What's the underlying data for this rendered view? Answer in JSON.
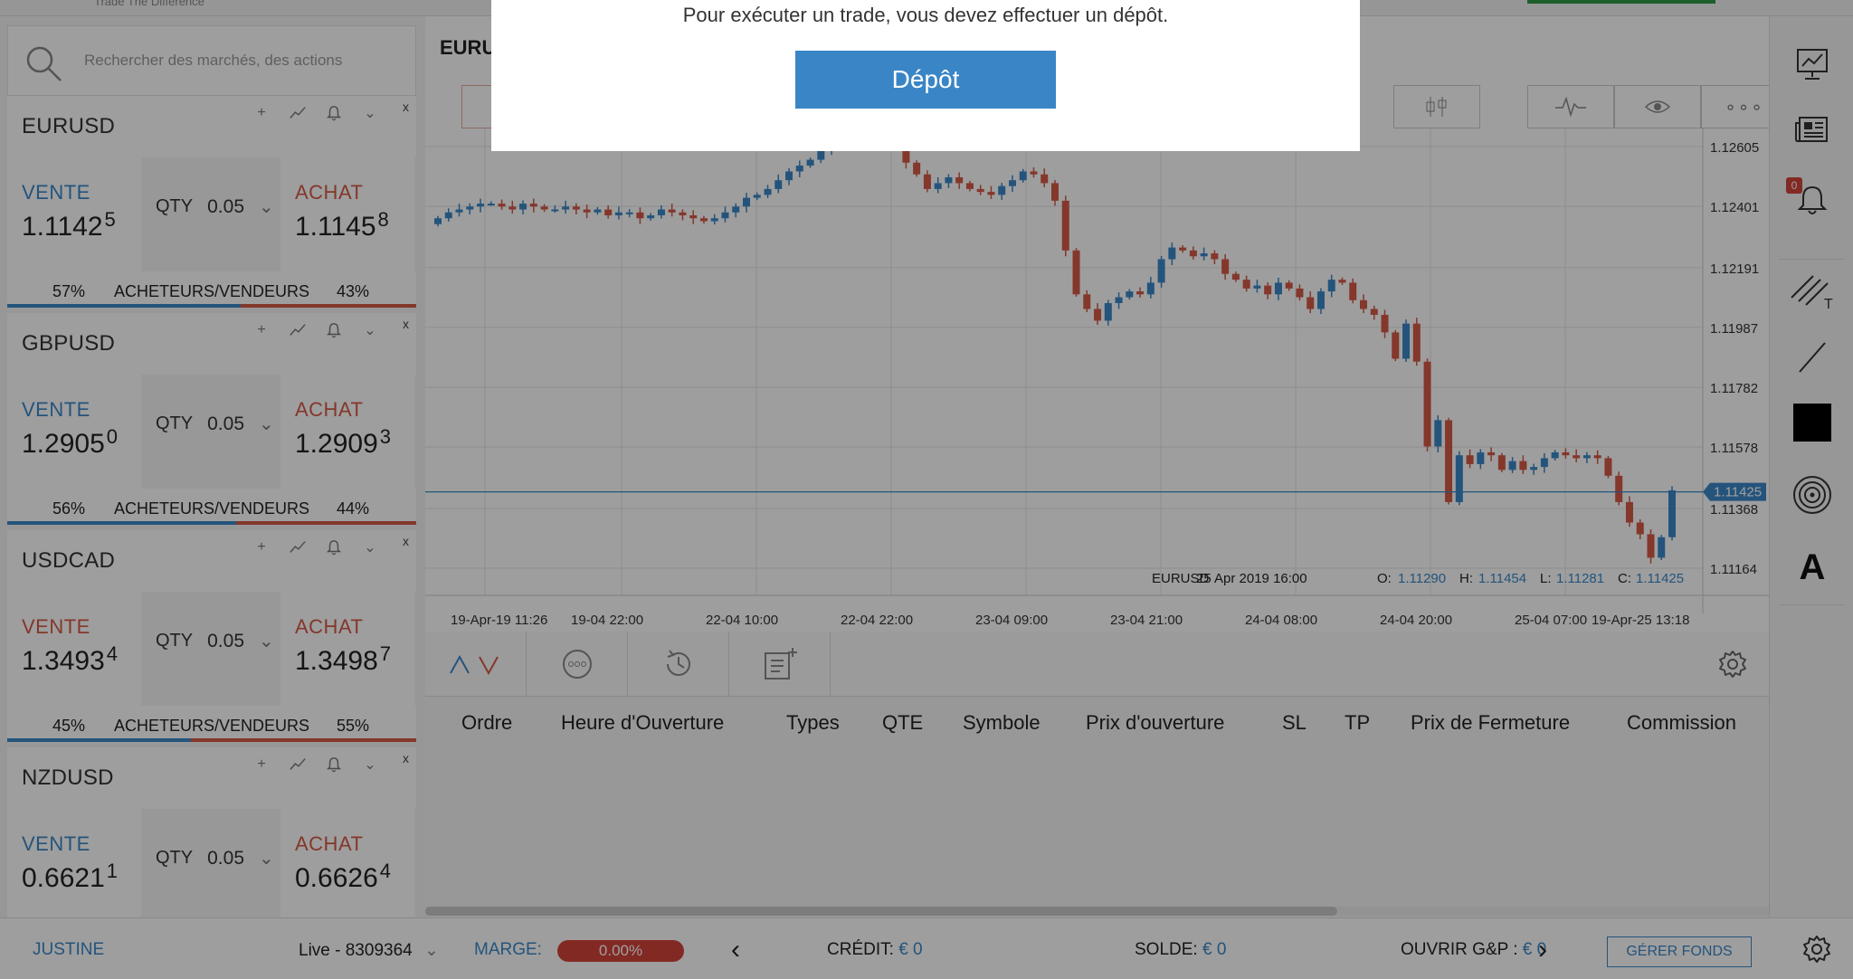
{
  "brand": {
    "tagline": "Trade The Difference"
  },
  "search": {
    "placeholder": "Rechercher des marchés, des actions"
  },
  "pairs": [
    {
      "name": "EURUSD",
      "sell_label": "VENTE",
      "sell_main": "1.1142",
      "sell_pip": "5",
      "sell_color": "blue",
      "qty_label": "QTY",
      "qty": "0.05",
      "buy_label": "ACHAT",
      "buy_main": "1.1145",
      "buy_pip": "8",
      "buyers_pct": "57%",
      "ratio_label": "ACHETEURS/VENDEURS",
      "sellers_pct": "43%",
      "buyers_frac": 0.57
    },
    {
      "name": "GBPUSD",
      "sell_label": "VENTE",
      "sell_main": "1.2905",
      "sell_pip": "0",
      "sell_color": "blue",
      "qty_label": "QTY",
      "qty": "0.05",
      "buy_label": "ACHAT",
      "buy_main": "1.2909",
      "buy_pip": "3",
      "buyers_pct": "56%",
      "ratio_label": "ACHETEURS/VENDEURS",
      "sellers_pct": "44%",
      "buyers_frac": 0.56
    },
    {
      "name": "USDCAD",
      "sell_label": "VENTE",
      "sell_main": "1.3493",
      "sell_pip": "4",
      "sell_color": "red",
      "qty_label": "QTY",
      "qty": "0.05",
      "buy_label": "ACHAT",
      "buy_main": "1.3498",
      "buy_pip": "7",
      "buyers_pct": "45%",
      "ratio_label": "ACHETEURS/VENDEURS",
      "sellers_pct": "55%",
      "buyers_frac": 0.45
    },
    {
      "name": "NZDUSD",
      "sell_label": "VENTE",
      "sell_main": "0.6621",
      "sell_pip": "1",
      "sell_color": "blue",
      "qty_label": "QTY",
      "qty": "0.05",
      "buy_label": "ACHAT",
      "buy_main": "0.6626",
      "buy_pip": "4"
    }
  ],
  "chart": {
    "title": "EURU",
    "y_ticks": [
      "1.12605",
      "1.12401",
      "1.12191",
      "1.11987",
      "1.11782",
      "1.11578",
      "1.11368",
      "1.11164"
    ],
    "y_values": [
      1.12605,
      1.12401,
      1.12191,
      1.11987,
      1.11782,
      1.11578,
      1.11368,
      1.11164
    ],
    "x_ticks": [
      "19-Apr-19 11:26",
      "19-04 22:00",
      "22-04 10:00",
      "22-04 22:00",
      "23-04 09:00",
      "23-04 21:00",
      "24-04 08:00",
      "24-04 20:00",
      "25-04 07:00",
      "19-Apr-25 13:18"
    ],
    "current_price": "1.11425",
    "current_value": 1.11425,
    "info": {
      "symbol": "EURUSD",
      "date": "25 Apr 2019 16:00",
      "o_label": "O:",
      "o": "1.11290",
      "h_label": "H:",
      "h": "1.11454",
      "l_label": "L:",
      "l": "1.11281",
      "c_label": "C:",
      "c": "1.11425"
    },
    "colors": {
      "up": "#3a88c9",
      "down": "#d65a46"
    }
  },
  "chart_data": {
    "type": "candlestick",
    "title": "EURU",
    "ylim": [
      1.11164,
      1.12605
    ],
    "closes": [
      1.1236,
      1.1238,
      1.1239,
      1.124,
      1.1241,
      1.1241,
      1.124,
      1.1239,
      1.1241,
      1.124,
      1.1239,
      1.1239,
      1.124,
      1.1239,
      1.1238,
      1.1239,
      1.1237,
      1.1238,
      1.1238,
      1.1236,
      1.1237,
      1.1239,
      1.1238,
      1.1237,
      1.1236,
      1.1235,
      1.1236,
      1.1238,
      1.124,
      1.1243,
      1.1244,
      1.1246,
      1.1249,
      1.1252,
      1.1254,
      1.1256,
      1.1259,
      1.1262,
      1.1262,
      1.1263,
      1.1261,
      1.1262,
      1.1263,
      1.1262,
      1.1255,
      1.1251,
      1.1246,
      1.1248,
      1.125,
      1.1248,
      1.1246,
      1.1245,
      1.1244,
      1.1247,
      1.1249,
      1.1252,
      1.1251,
      1.1248,
      1.1242,
      1.1225,
      1.121,
      1.1205,
      1.1201,
      1.1207,
      1.1209,
      1.1211,
      1.121,
      1.1214,
      1.1222,
      1.1226,
      1.1225,
      1.1223,
      1.1224,
      1.1222,
      1.1217,
      1.1215,
      1.1212,
      1.1213,
      1.121,
      1.1214,
      1.1212,
      1.1209,
      1.1205,
      1.1211,
      1.1215,
      1.1214,
      1.1208,
      1.1205,
      1.1203,
      1.1197,
      1.1188,
      1.12,
      1.1187,
      1.1158,
      1.1167,
      1.1139,
      1.1155,
      1.1152,
      1.1156,
      1.1155,
      1.115,
      1.1153,
      1.115,
      1.1151,
      1.1154,
      1.1156,
      1.1155,
      1.1154,
      1.1155,
      1.1154,
      1.1148,
      1.1139,
      1.1132,
      1.1128,
      1.112,
      1.1127,
      1.1143
    ]
  },
  "panel": {
    "columns": [
      "Ordre",
      "Heure d'Ouverture",
      "Types",
      "QTE",
      "Symbole",
      "Prix d'ouverture",
      "SL",
      "TP",
      "Prix de Fermeture",
      "Commission"
    ]
  },
  "rightbar": {
    "alerts_badge": "0",
    "text_tool": "A"
  },
  "status": {
    "user": "JUSTINE",
    "account": "Live - 8309364",
    "margin_label": "MARGE:",
    "margin_value": "0.00%",
    "credit_label": "CRÉDIT:",
    "credit_value": "€ 0",
    "balance_label": "SOLDE:",
    "balance_value": "€ 0",
    "open_pnl_label": "OUVRIR G&P :",
    "open_pnl_value": "€ 0",
    "manage_funds": "GÉRER FONDS"
  },
  "modal": {
    "message": "Pour exécuter un trade, vous devez effectuer un dépôt.",
    "button": "Dépôt"
  }
}
